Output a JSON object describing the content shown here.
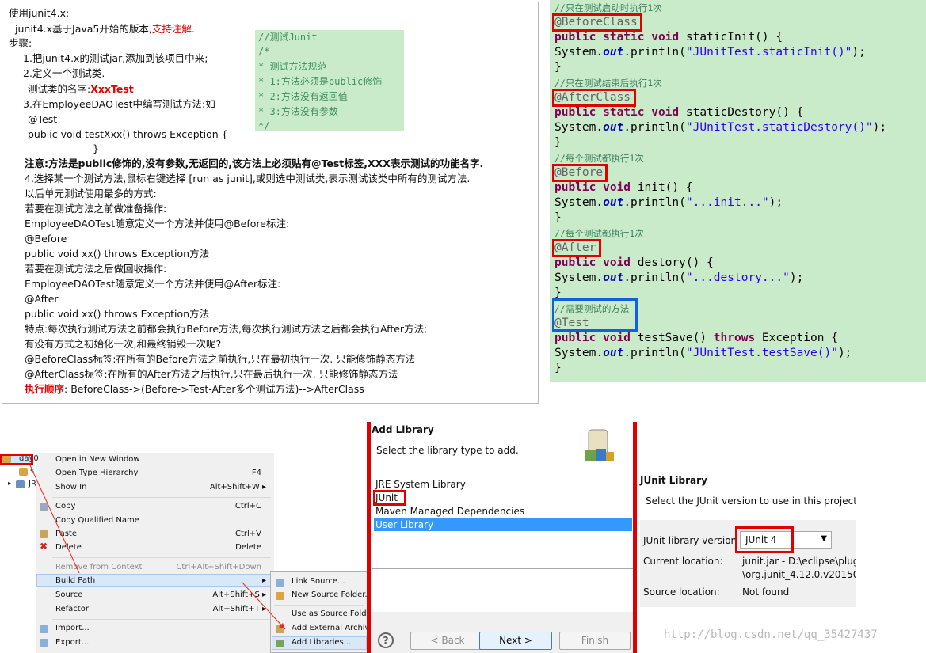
{
  "notes": {
    "title": "使用junit4.x:",
    "intro_prefix": "junit4.x基于Java5开始的版本,",
    "intro_highlight": "支持注解.",
    "steps_label": "步骤:",
    "step1": "1.把junit4.x的测试jar,添加到该项目中来;",
    "step2": "2.定义一个测试类.",
    "step2_name_prefix": "测试类的名字:",
    "step2_name_value": "XxxTest",
    "step3": "3.在EmployeeDAOTest中编写测试方法:如",
    "code_test": "@Test",
    "code_sig": "public void testXxx() throws Exception {",
    "code_close": "}",
    "note_label": "注意:",
    "note_text": "方法是public修饰的,没有参数,无返回的,该方法上必须贴有@Test标签,XXX表示测试的功能名字.",
    "step4": "4.选择某一个测试方法,鼠标右键选择 [run as junit],或则选中测试类,表示测试该类中所有的测试方法.",
    "line_common": "以后单元测试使用最多的方式:",
    "line_before_q": "若要在测试方法之前做准备操作:",
    "line_before_def": "EmployeeDAOTest随意定义一个方法并使用@Before标注:",
    "line_before_ann": "@Before",
    "line_before_sig": "public void xx() throws Exception方法",
    "line_after_q": "若要在测试方法之后做回收操作:",
    "line_after_def": "EmployeeDAOTest随意定义一个方法并使用@After标注:",
    "line_after_ann": "@After",
    "line_after_sig": "public void xx() throws Exception方法",
    "line_feature": "特点:每次执行测试方法之前都会执行Before方法,每次执行测试方法之后都会执行After方法;",
    "line_question": "有没有方式之初始化一次,和最终销毁一次呢?",
    "line_beforeclass": "@BeforeClass标签:在所有的Before方法之前执行,只在最初执行一次. 只能修饰静态方法",
    "line_afterclass": "@AfterClass标签:在所有的After方法之后执行,只在最后执行一次.  只能修饰静态方法",
    "order_label": "执行顺序",
    "order_text": ": BeforeClass->(Before->Test-After多个测试方法)-->AfterClass"
  },
  "rules_box": {
    "lines": [
      "//测试Junit",
      "/*",
      " *  测试方法规范",
      " * 1:方法必须是public修饰",
      " * 2:方法没有返回值",
      " * 3:方法没有参数",
      " */"
    ]
  },
  "code": {
    "c1": "//只在测试启动时执行1次",
    "a1": "@BeforeClass",
    "s1_kw": "public static void",
    "s1_rest": " staticInit() {",
    "b1_pre": "    System.",
    "out": "out",
    "b1_mid": ".println(",
    "b1_str": "\"JUnitTest.staticInit()\"",
    "end": ");",
    "close": "}",
    "c2": "//只在测试结束后执行1次",
    "a2": "@AfterClass",
    "s2_rest": " staticDestory() {",
    "b2_str": "\"JUnitTest.staticDestory()\"",
    "c3": "//每个测试都执行1次",
    "a3": "@Before",
    "s3_kw": "public void",
    "s3_rest": " init()  {",
    "b3_str": "\"...init...\"",
    "c4": "//每个测试都执行1次",
    "a4": "@After",
    "s4_rest": " destory()  {",
    "b4_str": "\"...destory...\"",
    "c5": "//需要测试的方法",
    "a5": "@Test",
    "s5_rest": " testSave() ",
    "s5_throws": "throws",
    "s5_exc": " Exception {",
    "b5_str": "\"JUnitTest.testSave()\""
  },
  "menu": {
    "tree_project": "day0",
    "tree_src": "s",
    "tree_jre": "JR",
    "items": [
      {
        "label": "Open in New Window",
        "shortcut": ""
      },
      {
        "label": "Open Type Hierarchy",
        "shortcut": "F4"
      },
      {
        "label": "Show In",
        "shortcut": "Alt+Shift+W ▸"
      },
      {
        "label": "Copy",
        "shortcut": "Ctrl+C"
      },
      {
        "label": "Copy Qualified Name",
        "shortcut": ""
      },
      {
        "label": "Paste",
        "shortcut": "Ctrl+V"
      },
      {
        "label": "Delete",
        "shortcut": "Delete"
      },
      {
        "label": "Remove from Context",
        "shortcut": "Ctrl+Alt+Shift+Down"
      },
      {
        "label": "Build Path",
        "shortcut": "▸"
      },
      {
        "label": "Source",
        "shortcut": "Alt+Shift+S ▸"
      },
      {
        "label": "Refactor",
        "shortcut": "Alt+Shift+T ▸"
      },
      {
        "label": "Import...",
        "shortcut": ""
      },
      {
        "label": "Export...",
        "shortcut": ""
      }
    ]
  },
  "submenu": {
    "items": [
      "Link Source...",
      "New Source Folder...",
      "Use as Source Folder",
      "Add External Archives...",
      "Add Libraries..."
    ]
  },
  "addlib": {
    "title": "Add Library",
    "subtitle": "Select the library type to add.",
    "items": [
      "JRE System Library",
      "JUnit",
      "Maven Managed Dependencies",
      "User Library"
    ],
    "help": "?",
    "back": "< Back",
    "next": "Next >",
    "finish": "Finish"
  },
  "junit": {
    "title": "JUnit Library",
    "subtitle": "Select the JUnit version to use in this project.",
    "version_label": "JUnit library version",
    "version_value": "JUnit 4",
    "current_label": "Current location:",
    "current_value1": "junit.jar - D:\\eclipse\\plug",
    "current_value2": "\\org.junit_4.12.0.v201504",
    "source_label": "Source location:",
    "source_value": "Not found"
  },
  "watermark": "http://blog.csdn.net/qq_35427437",
  "colors": {
    "code_bg": "#c9ebc9",
    "highlight_red": "#e00000",
    "highlight_blue": "#1060e0",
    "keyword": "#7f0055",
    "string": "#2a00ff"
  }
}
